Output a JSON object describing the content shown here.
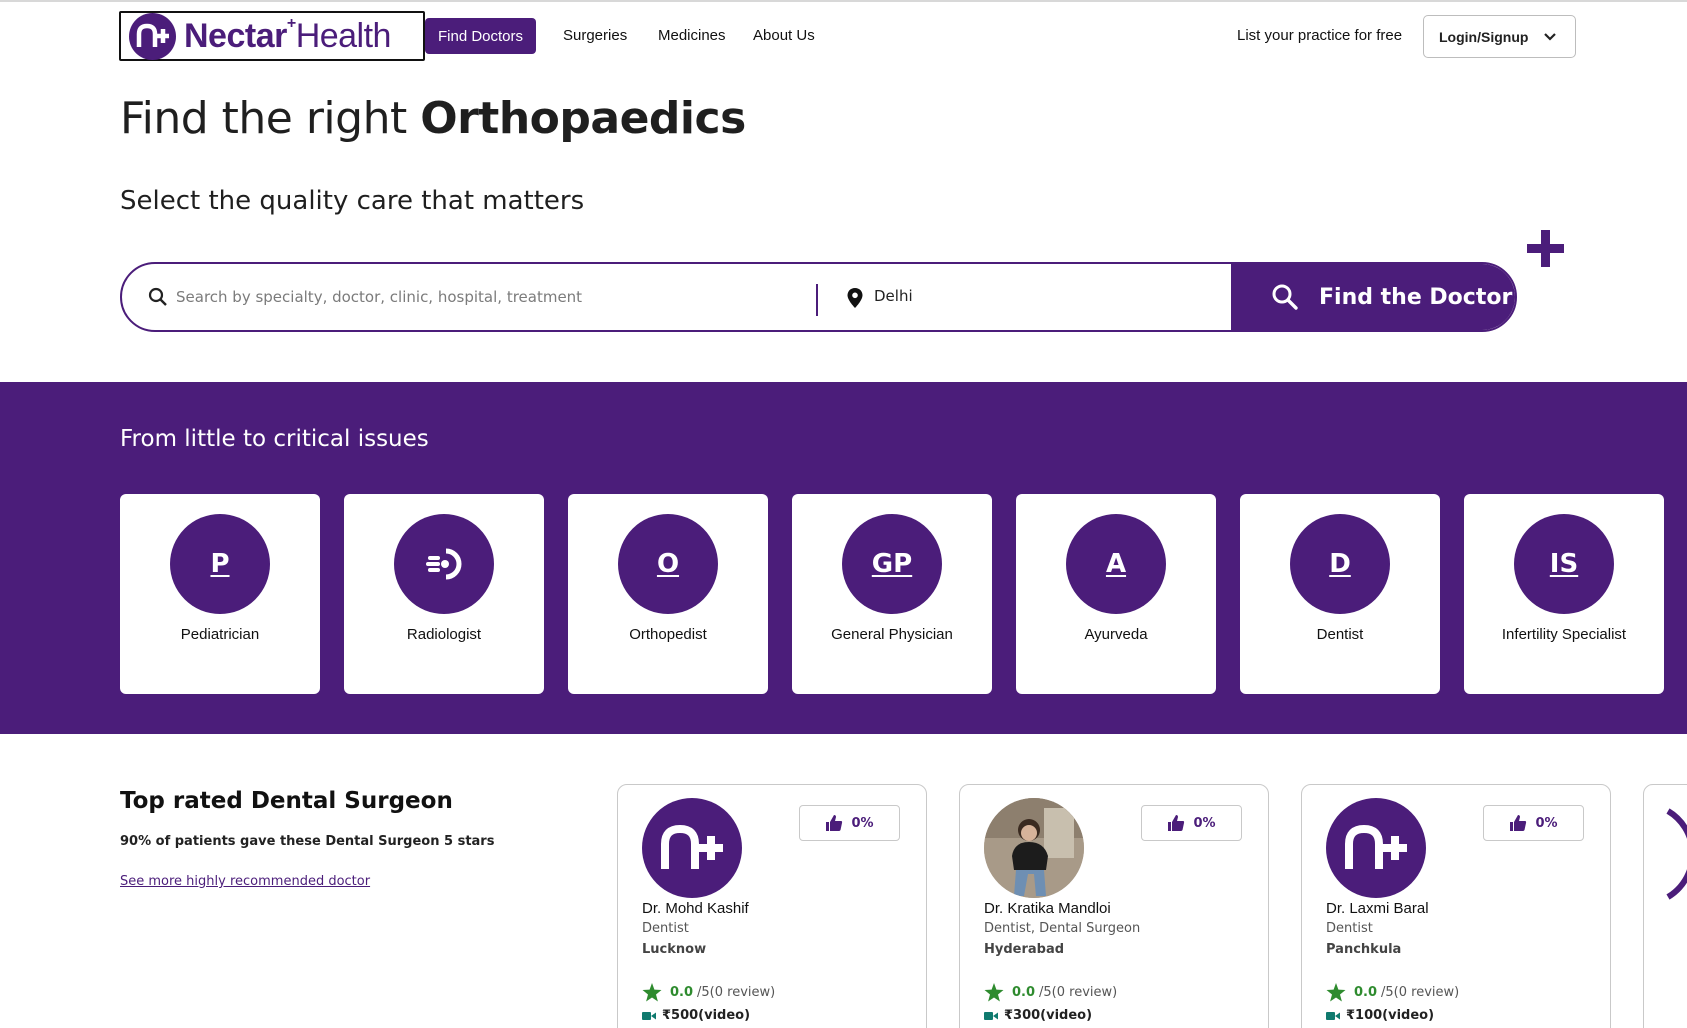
{
  "header": {
    "logo": {
      "brand_bold": "Nectar",
      "brand_light": "Health",
      "mark_label": "n+"
    },
    "nav": [
      {
        "label": "Find Doctors",
        "active": true
      },
      {
        "label": "Surgeries",
        "active": false
      },
      {
        "label": "Medicines",
        "active": false
      },
      {
        "label": "About Us",
        "active": false
      }
    ],
    "list_practice": "List your practice for free",
    "login_label": "Login/Signup"
  },
  "hero": {
    "title_prefix": "Find the right ",
    "title_specialty": "Orthopaedics",
    "subtitle": "Select the quality care that matters"
  },
  "search": {
    "placeholder": "Search by specialty, doctor, clinic, hospital, treatment",
    "location_value": "Delhi",
    "button_label": "Find the Doctor"
  },
  "specialties": {
    "title": "From little to critical issues",
    "items": [
      {
        "initials": "P",
        "label": "Pediatrician",
        "icon": null
      },
      {
        "initials": "",
        "label": "Radiologist",
        "icon": "radiology-icon"
      },
      {
        "initials": "O",
        "label": "Orthopedist",
        "icon": null
      },
      {
        "initials": "GP",
        "label": "General Physician",
        "icon": null
      },
      {
        "initials": "A",
        "label": "Ayurveda",
        "icon": null
      },
      {
        "initials": "D",
        "label": "Dentist",
        "icon": null
      },
      {
        "initials": "IS",
        "label": "Infertility Specialist",
        "icon": null
      }
    ]
  },
  "top_rated": {
    "title": "Top rated Dental Surgeon",
    "subtitle": "90% of patients gave these Dental Surgeon 5 stars",
    "link": "See more highly recommended doctor",
    "doctors": [
      {
        "name": "Dr. Mohd Kashif",
        "specialty": "Dentist",
        "city": "Lucknow",
        "recommend": "0%",
        "score": "0.0",
        "rating_suffix": "/5(0 review)",
        "fee": "₹500(video)",
        "avatar": "logo"
      },
      {
        "name": "Dr. Kratika Mandloi",
        "specialty": "Dentist, Dental Surgeon",
        "city": "Hyderabad",
        "recommend": "0%",
        "score": "0.0",
        "rating_suffix": "/5(0 review)",
        "fee": "₹300(video)",
        "avatar": "photo"
      },
      {
        "name": "Dr. Laxmi Baral",
        "specialty": "Dentist",
        "city": "Panchkula",
        "recommend": "0%",
        "score": "0.0",
        "rating_suffix": "/5(0 review)",
        "fee": "₹100(video)",
        "avatar": "logo"
      }
    ]
  },
  "colors": {
    "brand": "#4b1d7a",
    "star": "#2e8b2e",
    "video": "#0f7a6e"
  }
}
